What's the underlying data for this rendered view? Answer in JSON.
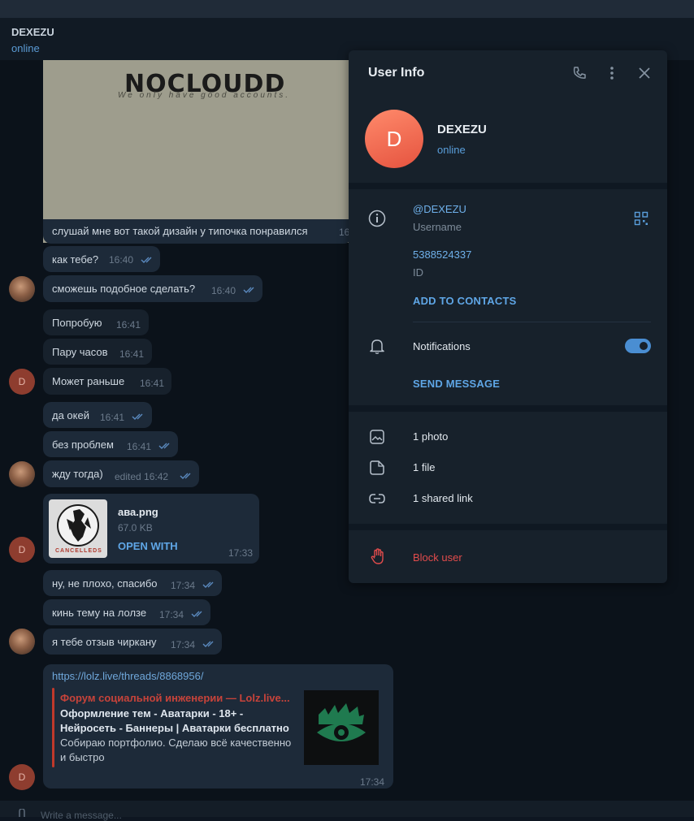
{
  "header": {
    "title": "DEXEZU",
    "status": "online"
  },
  "image_message": {
    "logo_text": "NOCLOUDD",
    "logo_sub": "We only have good accounts.",
    "caption": "слушай мне вот такой дизайн у типочка понравился",
    "time": "16"
  },
  "messages": [
    {
      "text": "как тебе?",
      "time": "16:40"
    },
    {
      "text": "сможешь подобное сделать?",
      "time": "16:40"
    },
    {
      "text": "Попробую",
      "time": "16:41"
    },
    {
      "text": "Пару часов",
      "time": "16:41"
    },
    {
      "text": "Может раньше",
      "time": "16:41"
    },
    {
      "text": "да окей",
      "time": "16:41"
    },
    {
      "text": "без проблем",
      "time": "16:41"
    },
    {
      "text": "жду тогда)",
      "time": "edited 16:42"
    },
    {
      "text": "ну, не плохо, спасибо",
      "time": "17:34"
    },
    {
      "text": "кинь тему на лолзе",
      "time": "17:34"
    },
    {
      "text": "я тебе отзыв чиркану",
      "time": "17:34"
    }
  ],
  "avatar_letter": "D",
  "file": {
    "name": "ава.png",
    "size": "67.0 KB",
    "open_label": "OPEN WITH",
    "time": "17:33",
    "thumb_text": "CANCELLEDS"
  },
  "link_preview": {
    "url": "https://lolz.live/threads/8868956/",
    "site": "Форум социальной инженерии — Lolz.live...",
    "title": "Оформление тем - Аватарки - 18+ - Нейросеть - Баннеры | Аватарки бесплатно",
    "description": "Собираю портфолио. Сделаю всё качественно и быстро",
    "time": "17:34"
  },
  "composer": {
    "placeholder": "Write a message..."
  },
  "user_info": {
    "title": "User Info",
    "avatar_letter": "D",
    "name": "DEXEZU",
    "status": "online",
    "username": "@DEXEZU",
    "username_label": "Username",
    "id": "5388524337",
    "id_label": "ID",
    "add_contacts": "ADD TO CONTACTS",
    "notifications": "Notifications",
    "notifications_on": true,
    "send_message": "SEND MESSAGE",
    "photos": "1 photo",
    "files": "1 file",
    "links": "1 shared link",
    "block": "Block user"
  },
  "colors": {
    "accent": "#5fa6e6",
    "danger": "#e24c4c",
    "bubble": "#1d2a39",
    "panel": "#17212b"
  }
}
